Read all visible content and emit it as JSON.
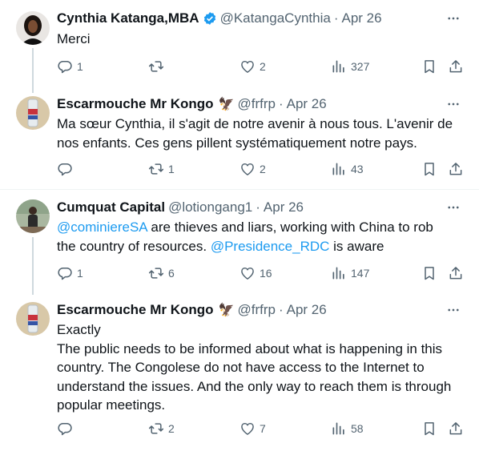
{
  "tweets": [
    {
      "name": "Cynthia Katanga,MBA",
      "verified": true,
      "handle": "@KatangaCynthia",
      "dot": "·",
      "date": "Apr 26",
      "lines": [
        {
          "text": "Merci"
        }
      ],
      "replies": "1",
      "retweets": "",
      "likes": "2",
      "views": "327"
    },
    {
      "name": "Escarmouche Mr Kongo",
      "emoji": "🦅",
      "handle": "@frfrp",
      "dot": "·",
      "date": "Apr 26",
      "lines": [
        {
          "text": "Ma sœur Cynthia, il s'agit de notre avenir à nous tous. L'avenir de"
        },
        {
          "text": "nos enfants. Ces gens pillent systématiquement notre pays."
        }
      ],
      "replies": "",
      "retweets": "1",
      "likes": "2",
      "views": "43"
    },
    {
      "name": "Cumquat Capital",
      "handle": "@lotiongang1",
      "dot": "·",
      "date": "Apr 26",
      "line1_mention": "@cominiereSA",
      "line1_rest": " are thieves and liars, working with China to rob",
      "line2_start": "the country of resources. ",
      "line2_mention": "@Presidence_RDC",
      "line2_end": " is aware",
      "replies": "1",
      "retweets": "6",
      "likes": "16",
      "views": "147"
    },
    {
      "name": "Escarmouche Mr Kongo",
      "emoji": "🦅",
      "handle": "@frfrp",
      "dot": "·",
      "date": "Apr 26",
      "lines": [
        {
          "text": "Exactly"
        },
        {
          "text": "The public needs to be informed about what is happening in this"
        },
        {
          "text": "country. The Congolese do not have access to the Internet to"
        },
        {
          "text": "understand the issues. And the only way to reach them is through"
        },
        {
          "text": "popular meetings."
        }
      ],
      "replies": "",
      "retweets": "2",
      "likes": "7",
      "views": "58"
    }
  ],
  "colors": {
    "text": "#0f1419",
    "secondary": "#536471",
    "accent": "#1d9bf0",
    "divider": "#eff3f4"
  },
  "icons": [
    "reply-icon",
    "retweet-icon",
    "like-icon",
    "views-icon",
    "bookmark-icon",
    "share-icon",
    "more-icon",
    "verified-badge-icon"
  ]
}
